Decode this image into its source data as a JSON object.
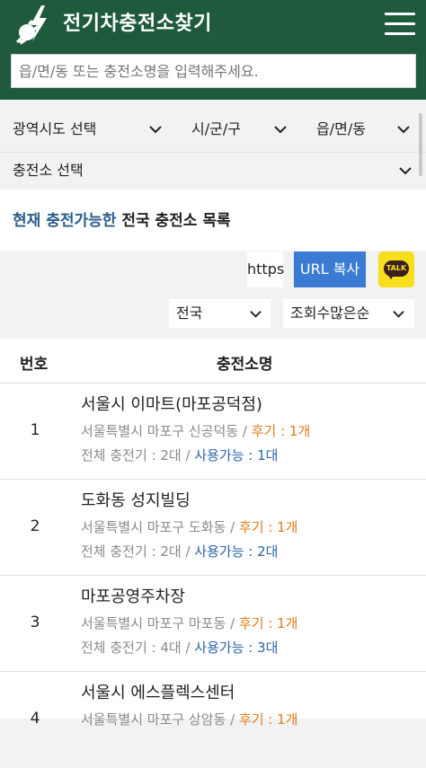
{
  "header": {
    "title": "전기차충전소찾기",
    "logo_icon": "ev-plug-icon",
    "menu_icon": "hamburger-menu-icon",
    "search_placeholder": "읍/면/동 또는 충전소명을 입력해주세요.",
    "bg_color": "#1f5a3c"
  },
  "filters": {
    "region": "광역시도 선택",
    "city": "시/군/구",
    "town": "읍/면/동",
    "station": "충전소 선택"
  },
  "list_heading": {
    "highlight": "현재 충전가능한",
    "rest": " 전국 충전소 목록"
  },
  "share": {
    "url_text": "https",
    "copy_label": "URL 복사",
    "kakao_label": "TALK"
  },
  "sort": {
    "area": "전국",
    "order": "조회수많은순"
  },
  "table": {
    "col_no": "번호",
    "col_name": "충전소명",
    "rows": [
      {
        "no": "1",
        "name": "서울시 이마트(마포공덕점)",
        "address": "서울특별시 마포구 신공덕동",
        "review_label": "후기 : 1개",
        "total": "전체 충전기 : 2대",
        "available_label": "사용가능 : 1대"
      },
      {
        "no": "2",
        "name": "도화동 성지빌딩",
        "address": "서울특별시 마포구 도화동",
        "review_label": "후기 : 1개",
        "total": "전체 충전기 : 2대",
        "available_label": "사용가능 : 2대"
      },
      {
        "no": "3",
        "name": "마포공영주차장",
        "address": "서울특별시 마포구 마포동",
        "review_label": "후기 : 1개",
        "total": "전체 충전기 : 4대",
        "available_label": "사용가능 : 3대"
      },
      {
        "no": "4",
        "name": "서울시 에스플렉스센터",
        "address": "서울특별시 마포구 상암동",
        "review_label": "후기 : 1개",
        "total": "",
        "available_label": ""
      }
    ]
  },
  "colors": {
    "accent_blue": "#3b7bd4",
    "review_orange": "#e07b1a",
    "available_blue": "#2a66a8",
    "kakao_yellow": "#f7df1e"
  }
}
